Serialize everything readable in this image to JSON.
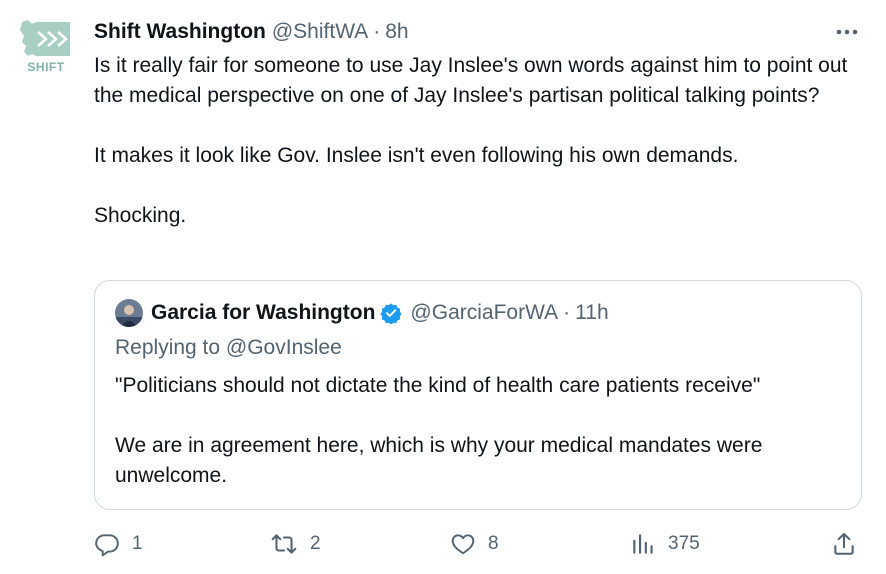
{
  "author": {
    "display_name": "Shift Washington",
    "handle": "@ShiftWA",
    "separator": "·",
    "time": "8h",
    "avatar_text": "SHIFT",
    "avatar_color": "#7fb3a6"
  },
  "more_icon": "more-horizontal-icon",
  "body": {
    "paragraph1": "Is it really fair for someone to use Jay Inslee's own words against him to point out the medical perspective on one of Jay Inslee's partisan political talking points?",
    "paragraph2": "It makes it look like Gov. Inslee isn't even following his own demands.",
    "paragraph3": "Shocking."
  },
  "quoted_tweet": {
    "display_name": "Garcia for Washington",
    "verified": true,
    "verified_color": "#1d9bf0",
    "handle": "@GarciaForWA",
    "separator": "·",
    "time": "11h",
    "replying_prefix": "Replying to",
    "replying_to": "@GovInslee",
    "paragraph1": "\"Politicians should not dictate the kind of health care patients receive\"",
    "paragraph2": "We are in agreement here, which is why your medical mandates were unwelcome."
  },
  "actions": {
    "reply": {
      "icon": "reply-icon",
      "count": "1"
    },
    "retweet": {
      "icon": "retweet-icon",
      "count": "2"
    },
    "like": {
      "icon": "heart-icon",
      "count": "8"
    },
    "views": {
      "icon": "views-chart-icon",
      "count": "375"
    },
    "share": {
      "icon": "share-icon"
    }
  },
  "colors": {
    "text": "#0f1419",
    "secondary": "#536471",
    "border": "#cfd9de"
  }
}
